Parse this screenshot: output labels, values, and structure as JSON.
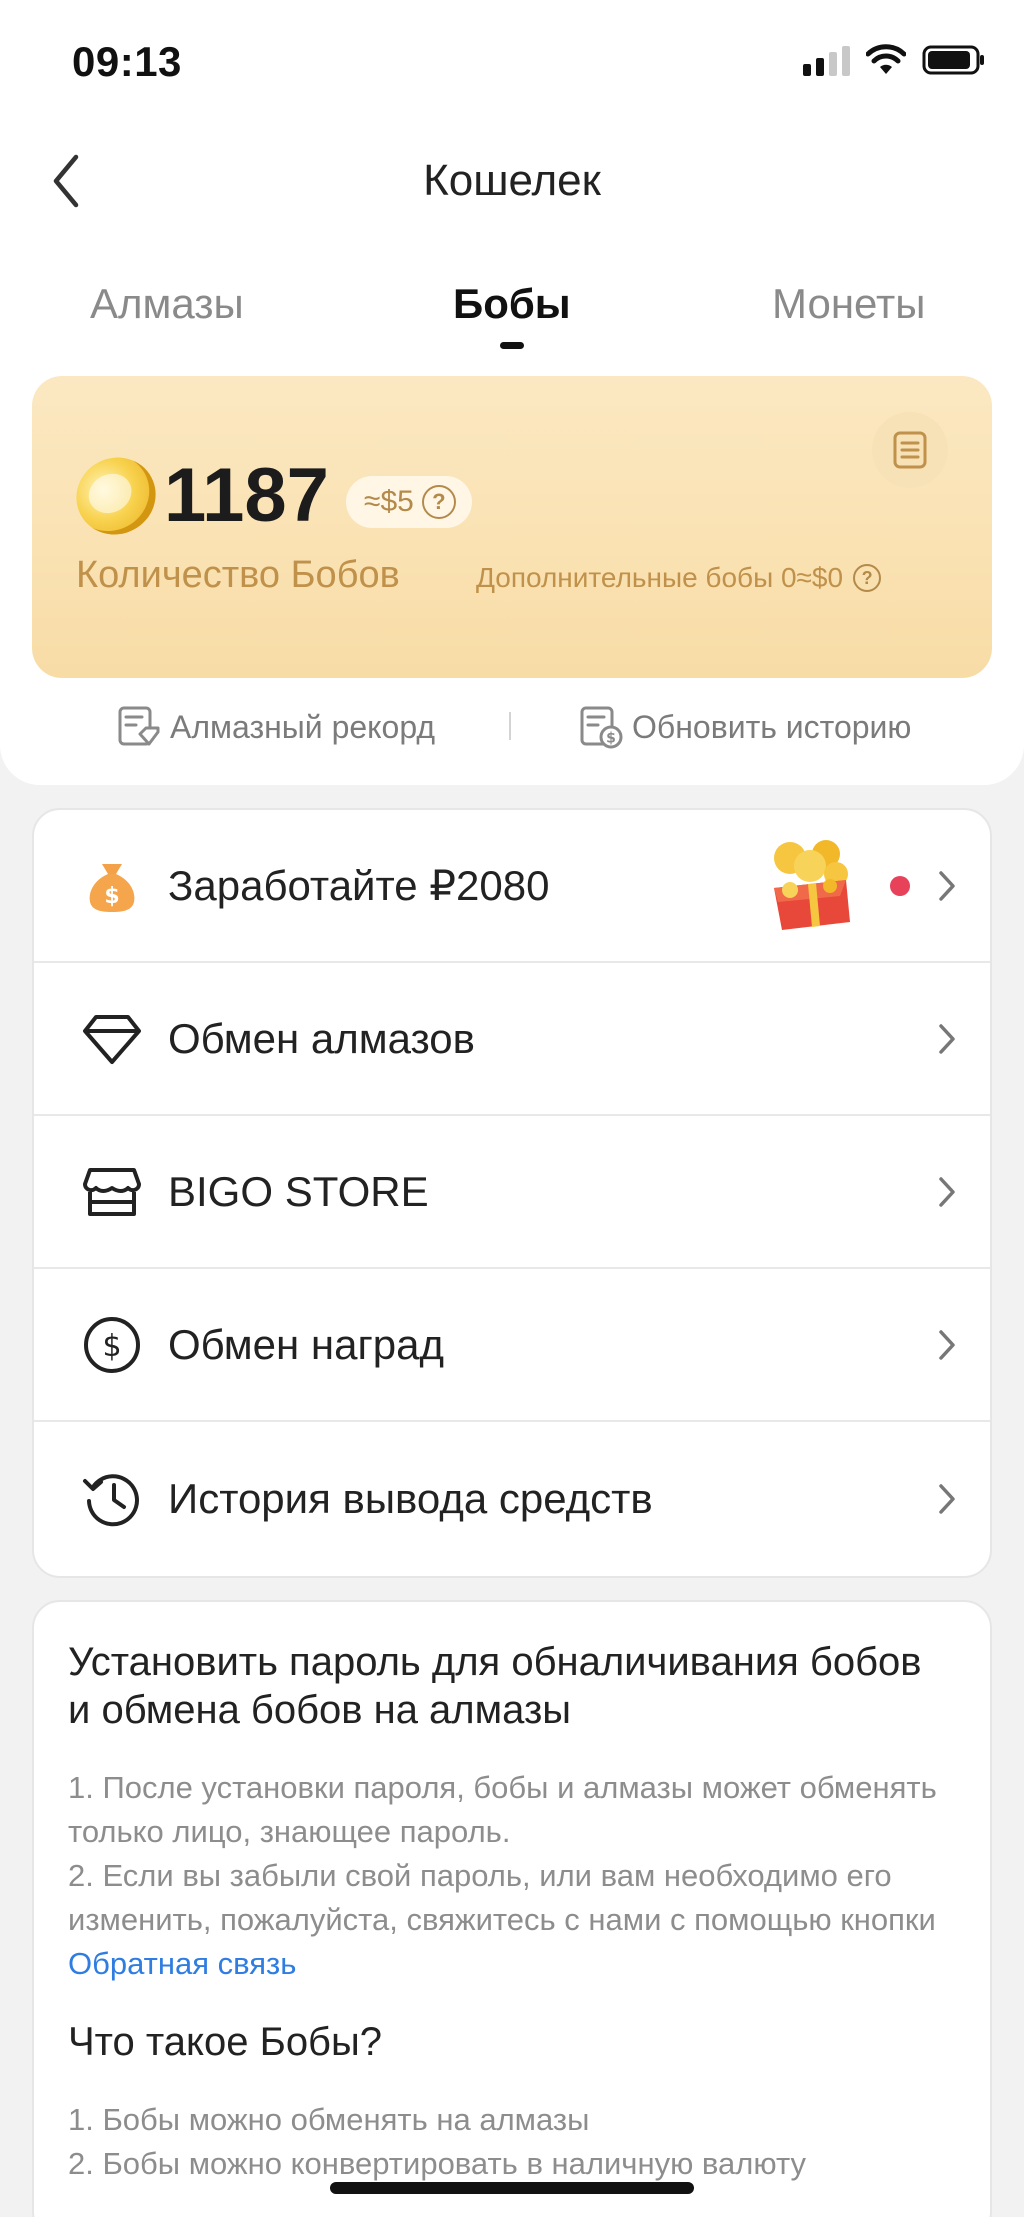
{
  "status_bar": {
    "time": "09:13"
  },
  "nav": {
    "title": "Кошелек"
  },
  "tabs": [
    {
      "label": "Алмазы"
    },
    {
      "label": "Бобы"
    },
    {
      "label": "Монеты"
    }
  ],
  "balance": {
    "amount": "1187",
    "usd_approx": "≈$5",
    "label": "Количество Бобов",
    "extra_beans": "Дополнительные бобы 0≈$0"
  },
  "records": {
    "diamond_record": "Алмазный рекорд",
    "update_history": "Обновить историю"
  },
  "menu": [
    {
      "label": "Заработайте ₽2080",
      "icon": "money-bag-icon"
    },
    {
      "label": "Обмен алмазов",
      "icon": "diamond-icon"
    },
    {
      "label": "BIGO STORE",
      "icon": "store-icon"
    },
    {
      "label": "Обмен наград",
      "icon": "dollar-circle-icon"
    },
    {
      "label": "История вывода средств",
      "icon": "history-icon"
    }
  ],
  "info": {
    "title": "Установить пароль для обналичивания бобов и обмена бобов на алмазы",
    "line1": "1. После установки пароля, бобы и алмазы может обменять только лицо, знающее пароль.",
    "line2_pre": "2. Если вы забыли свой пароль, или вам необходимо его изменить, пожалуйста, свяжитесь с нами с помощью кнопки ",
    "line2_link": "Обратная связь",
    "subtitle": "Что такое Бобы?",
    "what1": "1. Бобы можно обменять на алмазы",
    "what2": "2. Бобы можно конвертировать в наличную валюту"
  },
  "colors": {
    "accent_gold": "#c0914a",
    "link_blue": "#2f7de1",
    "notification_red": "#e8415a"
  }
}
